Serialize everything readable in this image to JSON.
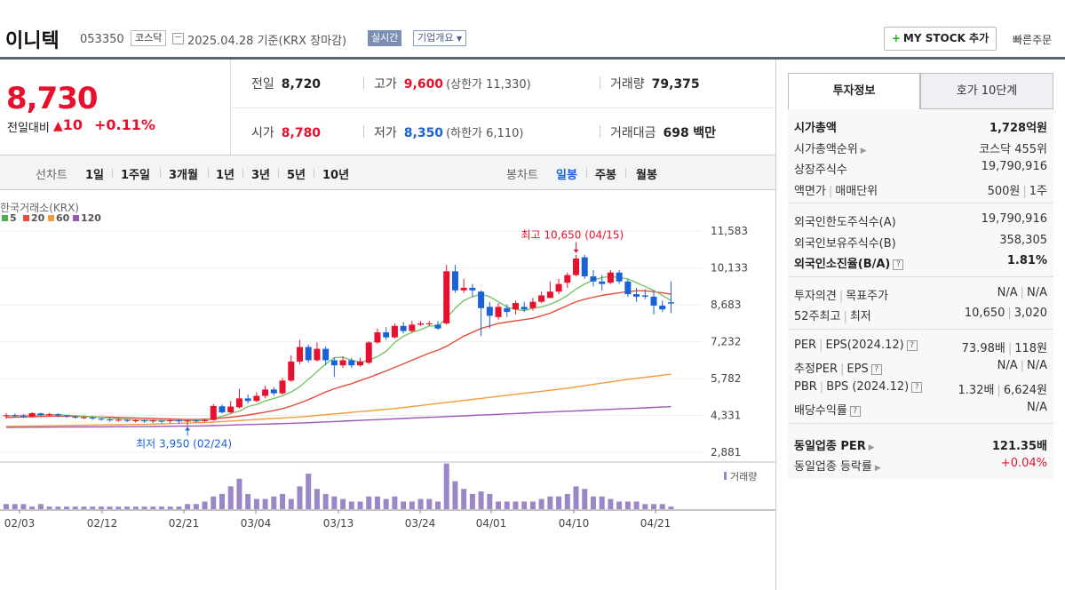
{
  "header": {
    "name": "이니텍",
    "code": "053350",
    "market": "코스닥",
    "date": "2025.04.28",
    "basis": "기준(KRX 장마감)",
    "realtime": "실시간",
    "company_info": "기업개요",
    "my_stock": "MY STOCK 추가",
    "quick_order": "빠른주문"
  },
  "price": {
    "current": "8,730",
    "compare_label": "전일대비",
    "change": "10",
    "change_pct": "+0.11%"
  },
  "stats": {
    "prev_label": "전일",
    "prev": "8,720",
    "high_label": "고가",
    "high": "9,600",
    "upper_label": "(상한가",
    "upper": "11,330",
    "upper_close": ")",
    "volume_label": "거래량",
    "volume": "79,375",
    "open_label": "시가",
    "open": "8,780",
    "low_label": "저가",
    "low": "8,350",
    "lower_label": "(하한가",
    "lower": "6,110",
    "lower_close": ")",
    "amount_label": "거래대금",
    "amount": "698",
    "amount_unit": "백만"
  },
  "toolbar": {
    "line_label": "선차트",
    "ranges": [
      "1일",
      "1주일",
      "3개월",
      "1년",
      "3년",
      "5년",
      "10년"
    ],
    "candle_label": "봉차트",
    "candles": [
      "일봉",
      "주봉",
      "월봉"
    ],
    "selected_candle": "일봉"
  },
  "chart_data": {
    "type": "candlestick",
    "source_label": "한국거래소(KRX)",
    "legend": [
      {
        "name": "5",
        "color": "#4caf50"
      },
      {
        "name": "20",
        "color": "#e74c3c"
      },
      {
        "name": "60",
        "color": "#f39c3c"
      },
      {
        "name": "120",
        "color": "#9b59b6"
      }
    ],
    "y_ticks": [
      11583,
      10133,
      8683,
      7232,
      5782,
      4331,
      2881
    ],
    "x_ticks": [
      "02/03",
      "02/12",
      "02/21",
      "03/04",
      "03/13",
      "03/24",
      "04/01",
      "04/10",
      "04/21"
    ],
    "high_annotation": "최고 10,650 (04/15)",
    "low_annotation": "최저 3,950 (02/24)",
    "volume_label": "거래량",
    "candles": [
      {
        "o": 4300,
        "c": 4340,
        "h": 4420,
        "l": 4200
      },
      {
        "o": 4340,
        "c": 4310,
        "h": 4400,
        "l": 4250
      },
      {
        "o": 4310,
        "c": 4300,
        "h": 4380,
        "l": 4230
      },
      {
        "o": 4290,
        "c": 4420,
        "h": 4460,
        "l": 4260
      },
      {
        "o": 4410,
        "c": 4340,
        "h": 4440,
        "l": 4300
      },
      {
        "o": 4340,
        "c": 4380,
        "h": 4430,
        "l": 4300
      },
      {
        "o": 4380,
        "c": 4330,
        "h": 4410,
        "l": 4270
      },
      {
        "o": 4330,
        "c": 4290,
        "h": 4360,
        "l": 4240
      },
      {
        "o": 4280,
        "c": 4250,
        "h": 4330,
        "l": 4200
      },
      {
        "o": 4250,
        "c": 4260,
        "h": 4300,
        "l": 4190
      },
      {
        "o": 4250,
        "c": 4210,
        "h": 4280,
        "l": 4150
      },
      {
        "o": 4200,
        "c": 4180,
        "h": 4240,
        "l": 4120
      },
      {
        "o": 4170,
        "c": 4150,
        "h": 4220,
        "l": 4090
      },
      {
        "o": 4140,
        "c": 4160,
        "h": 4200,
        "l": 4080
      },
      {
        "o": 4150,
        "c": 4130,
        "h": 4190,
        "l": 4060
      },
      {
        "o": 4120,
        "c": 4140,
        "h": 4180,
        "l": 4050
      },
      {
        "o": 4130,
        "c": 4120,
        "h": 4170,
        "l": 4040
      },
      {
        "o": 4110,
        "c": 4130,
        "h": 4170,
        "l": 4030
      },
      {
        "o": 4120,
        "c": 4110,
        "h": 4150,
        "l": 4020
      },
      {
        "o": 4110,
        "c": 4140,
        "h": 4170,
        "l": 4030
      },
      {
        "o": 4140,
        "c": 4100,
        "h": 4180,
        "l": 4000
      },
      {
        "o": 4100,
        "c": 4130,
        "h": 4170,
        "l": 3950
      },
      {
        "o": 4130,
        "c": 4120,
        "h": 4180,
        "l": 4050
      },
      {
        "o": 4120,
        "c": 4140,
        "h": 4200,
        "l": 4060
      },
      {
        "o": 4150,
        "c": 4700,
        "h": 4780,
        "l": 4120
      },
      {
        "o": 4690,
        "c": 4450,
        "h": 4760,
        "l": 4400
      },
      {
        "o": 4450,
        "c": 4680,
        "h": 4900,
        "l": 4400
      },
      {
        "o": 4650,
        "c": 5000,
        "h": 5380,
        "l": 4600
      },
      {
        "o": 5000,
        "c": 4900,
        "h": 5160,
        "l": 4800
      },
      {
        "o": 4900,
        "c": 5100,
        "h": 5250,
        "l": 4850
      },
      {
        "o": 5100,
        "c": 5350,
        "h": 5500,
        "l": 5000
      },
      {
        "o": 5350,
        "c": 5200,
        "h": 5450,
        "l": 5100
      },
      {
        "o": 5200,
        "c": 5700,
        "h": 5800,
        "l": 5150
      },
      {
        "o": 5700,
        "c": 6450,
        "h": 6700,
        "l": 5650
      },
      {
        "o": 6450,
        "c": 7020,
        "h": 7300,
        "l": 6350
      },
      {
        "o": 7020,
        "c": 6500,
        "h": 7120,
        "l": 6400
      },
      {
        "o": 6500,
        "c": 6950,
        "h": 7200,
        "l": 6450
      },
      {
        "o": 6950,
        "c": 6500,
        "h": 7050,
        "l": 6300
      },
      {
        "o": 6500,
        "c": 6300,
        "h": 6600,
        "l": 5840
      },
      {
        "o": 6300,
        "c": 6500,
        "h": 6650,
        "l": 6200
      },
      {
        "o": 6500,
        "c": 6300,
        "h": 6600,
        "l": 6200
      },
      {
        "o": 6300,
        "c": 6450,
        "h": 6600,
        "l": 6250
      },
      {
        "o": 6400,
        "c": 7200,
        "h": 7250,
        "l": 6350
      },
      {
        "o": 7200,
        "c": 7600,
        "h": 7750,
        "l": 7150
      },
      {
        "o": 7600,
        "c": 7400,
        "h": 7800,
        "l": 7300
      },
      {
        "o": 7400,
        "c": 7850,
        "h": 7950,
        "l": 7350
      },
      {
        "o": 7850,
        "c": 7650,
        "h": 8000,
        "l": 7550
      },
      {
        "o": 7650,
        "c": 7900,
        "h": 8050,
        "l": 7600
      },
      {
        "o": 7900,
        "c": 7950,
        "h": 8050,
        "l": 7850
      },
      {
        "o": 7950,
        "c": 7950,
        "h": 8050,
        "l": 7850
      },
      {
        "o": 7900,
        "c": 7750,
        "h": 8050,
        "l": 7700
      },
      {
        "o": 7950,
        "c": 10000,
        "h": 10250,
        "l": 7900
      },
      {
        "o": 10000,
        "c": 9250,
        "h": 10250,
        "l": 9150
      },
      {
        "o": 9250,
        "c": 9350,
        "h": 9700,
        "l": 9150
      },
      {
        "o": 9350,
        "c": 9250,
        "h": 9500,
        "l": 9000
      },
      {
        "o": 9200,
        "c": 8550,
        "h": 9250,
        "l": 7450
      },
      {
        "o": 8600,
        "c": 8250,
        "h": 8800,
        "l": 7750
      },
      {
        "o": 8200,
        "c": 8600,
        "h": 8750,
        "l": 8100
      },
      {
        "o": 8550,
        "c": 8400,
        "h": 8700,
        "l": 8200
      },
      {
        "o": 8500,
        "c": 8750,
        "h": 8850,
        "l": 8300
      },
      {
        "o": 8600,
        "c": 8500,
        "h": 8800,
        "l": 8400
      },
      {
        "o": 8550,
        "c": 8800,
        "h": 8950,
        "l": 8450
      },
      {
        "o": 8800,
        "c": 9050,
        "h": 9200,
        "l": 8750
      },
      {
        "o": 8950,
        "c": 9200,
        "h": 9600,
        "l": 8950
      },
      {
        "o": 9200,
        "c": 9500,
        "h": 9700,
        "l": 9100
      },
      {
        "o": 9550,
        "c": 9850,
        "h": 9950,
        "l": 9350
      },
      {
        "o": 9850,
        "c": 10500,
        "h": 10650,
        "l": 9800
      },
      {
        "o": 10550,
        "c": 9800,
        "h": 10650,
        "l": 9700
      },
      {
        "o": 9800,
        "c": 9600,
        "h": 10050,
        "l": 9400
      },
      {
        "o": 9600,
        "c": 9500,
        "h": 9850,
        "l": 9250
      },
      {
        "o": 9550,
        "c": 9950,
        "h": 10050,
        "l": 9500
      },
      {
        "o": 9950,
        "c": 9600,
        "h": 10050,
        "l": 9500
      },
      {
        "o": 9600,
        "c": 9100,
        "h": 9700,
        "l": 9000
      },
      {
        "o": 9100,
        "c": 9000,
        "h": 9350,
        "l": 8800
      },
      {
        "o": 9050,
        "c": 9000,
        "h": 9300,
        "l": 8900
      },
      {
        "o": 9000,
        "c": 8650,
        "h": 9250,
        "l": 8300
      },
      {
        "o": 8650,
        "c": 8500,
        "h": 8850,
        "l": 8400
      },
      {
        "o": 8780,
        "c": 8730,
        "h": 9600,
        "l": 8350
      }
    ],
    "ma5": [
      4310,
      4320,
      4330,
      4340,
      4345,
      4350,
      4350,
      4340,
      4320,
      4300,
      4280,
      4250,
      4220,
      4200,
      4180,
      4160,
      4150,
      4140,
      4135,
      4130,
      4125,
      4120,
      4120,
      4125,
      4220,
      4300,
      4400,
      4500,
      4680,
      4760,
      4900,
      5000,
      5100,
      5250,
      5460,
      5750,
      6050,
      6350,
      6600,
      6620,
      6500,
      6420,
      6500,
      6650,
      6850,
      7200,
      7450,
      7600,
      7700,
      7850,
      7850,
      8150,
      8550,
      8850,
      9000,
      9100,
      9000,
      8800,
      8600,
      8500,
      8450,
      8550,
      8600,
      8700,
      8850,
      9050,
      9300,
      9500,
      9650,
      9750,
      9800,
      9750,
      9700,
      9550,
      9400,
      9250,
      9050,
      8850
    ],
    "ma20": [
      4250,
      4260,
      4270,
      4280,
      4290,
      4300,
      4300,
      4300,
      4300,
      4290,
      4280,
      4270,
      4260,
      4250,
      4240,
      4230,
      4220,
      4210,
      4200,
      4190,
      4180,
      4170,
      4170,
      4180,
      4200,
      4230,
      4260,
      4300,
      4350,
      4400,
      4460,
      4520,
      4600,
      4700,
      4820,
      4950,
      5100,
      5250,
      5380,
      5480,
      5580,
      5700,
      5820,
      5950,
      6080,
      6220,
      6360,
      6500,
      6640,
      6780,
      6900,
      7050,
      7250,
      7450,
      7600,
      7750,
      7850,
      7950,
      8000,
      8050,
      8100,
      8150,
      8250,
      8350,
      8500,
      8650,
      8800,
      8900,
      8980,
      9050,
      9100,
      9150,
      9200,
      9230,
      9230,
      9200,
      9150,
      9100
    ],
    "ma60": [
      3900,
      3905,
      3910,
      3915,
      3920,
      3925,
      3930,
      3935,
      3940,
      3945,
      3950,
      3955,
      3960,
      3965,
      3970,
      3975,
      3980,
      3990,
      4000,
      4010,
      4020,
      4030,
      4040,
      4050,
      4070,
      4090,
      4110,
      4130,
      4150,
      4170,
      4190,
      4210,
      4230,
      4250,
      4270,
      4300,
      4330,
      4360,
      4390,
      4420,
      4450,
      4480,
      4510,
      4540,
      4570,
      4600,
      4640,
      4680,
      4720,
      4760,
      4800,
      4840,
      4880,
      4920,
      4960,
      5000,
      5040,
      5080,
      5120,
      5160,
      5200,
      5240,
      5280,
      5320,
      5360,
      5400,
      5450,
      5500,
      5550,
      5600,
      5650,
      5700,
      5750,
      5790,
      5830,
      5870,
      5910,
      5950
    ],
    "ma120": [
      3860,
      3862,
      3864,
      3866,
      3868,
      3870,
      3872,
      3874,
      3876,
      3878,
      3880,
      3882,
      3884,
      3886,
      3888,
      3890,
      3892,
      3896,
      3900,
      3904,
      3908,
      3912,
      3916,
      3920,
      3930,
      3940,
      3950,
      3960,
      3970,
      3980,
      3990,
      4000,
      4010,
      4020,
      4030,
      4045,
      4060,
      4075,
      4090,
      4105,
      4120,
      4135,
      4150,
      4165,
      4180,
      4195,
      4210,
      4225,
      4240,
      4255,
      4270,
      4285,
      4300,
      4315,
      4330,
      4345,
      4360,
      4375,
      4390,
      4405,
      4420,
      4435,
      4450,
      4465,
      4480,
      4495,
      4510,
      4525,
      4540,
      4555,
      4570,
      4585,
      4600,
      4615,
      4630,
      4645,
      4660,
      4675
    ],
    "volumes": [
      2,
      2,
      2,
      1,
      2,
      1,
      1,
      1,
      1,
      1,
      1,
      1,
      1,
      1,
      1,
      1,
      1,
      1,
      1,
      1,
      1,
      2,
      2,
      3,
      5,
      6,
      9,
      12,
      6,
      4,
      4,
      5,
      6,
      4,
      9,
      14,
      8,
      6,
      5,
      4,
      3,
      3,
      5,
      5,
      4,
      5,
      3,
      3,
      4,
      4,
      3,
      18,
      11,
      8,
      6,
      7,
      6,
      3,
      3,
      3,
      3,
      3,
      4,
      5,
      5,
      6,
      9,
      8,
      5,
      5,
      4,
      3,
      3,
      3,
      2,
      2,
      2,
      1
    ]
  },
  "right_panel": {
    "tab1": "투자정보",
    "tab2": "호가 10단계",
    "market_cap_label": "시가총액",
    "market_cap": "1,728억원",
    "rank_label": "시가총액순위",
    "rank": "코스닥 455위",
    "shares_label": "상장주식수",
    "shares": "19,790,916",
    "par_label": "액면가",
    "unit_label": "매매단위",
    "par": "500원",
    "unit": "1주",
    "foreign_limit_label": "외국인한도주식수(A)",
    "foreign_limit": "19,790,916",
    "foreign_hold_label": "외국인보유주식수(B)",
    "foreign_hold": "358,305",
    "foreign_ratio_label": "외국인소진율(B/A)",
    "foreign_ratio": "1.81%",
    "opinion_label": "투자의견",
    "target_label": "목표주가",
    "opinion": "N/A",
    "target": "N/A",
    "w52_high_label": "52주최고",
    "w52_low_label": "최저",
    "w52_high": "10,650",
    "w52_low": "3,020",
    "per_label": "PER",
    "eps_label": "EPS(2024.12)",
    "per": "73.98배",
    "eps": "118원",
    "est_per_label": "추정PER",
    "est_eps_label": "EPS",
    "est_per": "N/A",
    "est_eps": "N/A",
    "pbr_label": "PBR",
    "bps_label": "BPS (2024.12)",
    "pbr": "1.32배",
    "bps": "6,624원",
    "div_label": "배당수익률",
    "div": "N/A",
    "ind_per_label": "동일업종 PER",
    "ind_per": "121.35배",
    "ind_rate_label": "동일업종 등락률",
    "ind_rate": "+0.04%"
  }
}
